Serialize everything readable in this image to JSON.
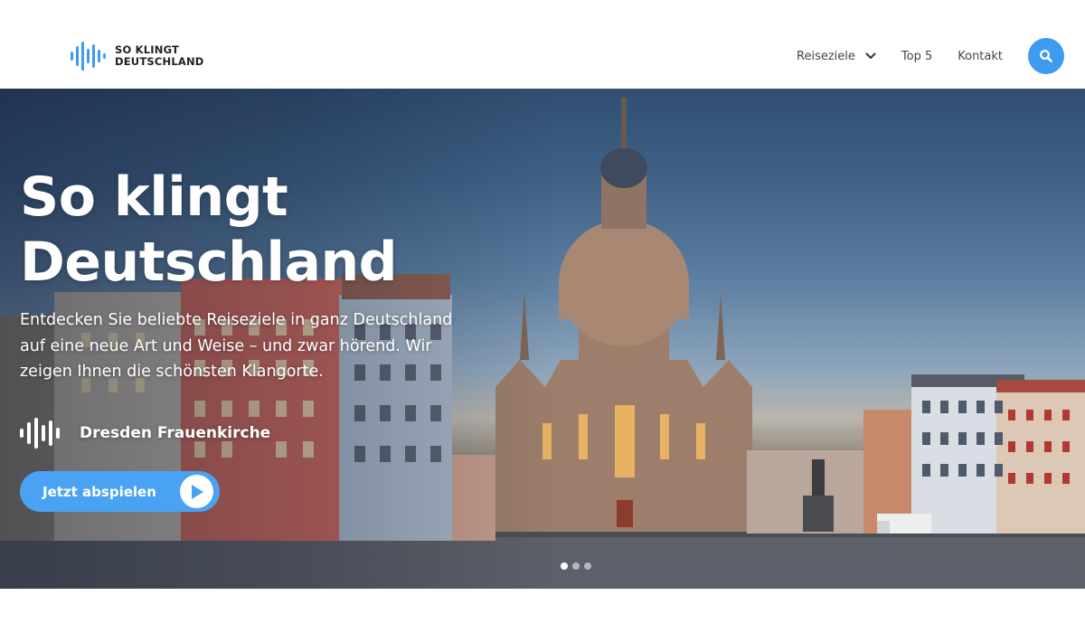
{
  "brand": {
    "line1": "SO KLINGT",
    "line2": "DEUTSCHLAND",
    "icon": "soundwave-logo-icon"
  },
  "nav": {
    "items": [
      {
        "label": "Reiseziele",
        "has_dropdown": true
      },
      {
        "label": "Top 5"
      },
      {
        "label": "Kontakt"
      }
    ],
    "search_icon": "search-icon"
  },
  "hero": {
    "title": "So klingt Deutschland",
    "subtitle": "Entdecken Sie beliebte Reiseziele in ganz Deutschland auf eine neue Art und Weise – und zwar hörend. Wir zeigen Ihnen die schönsten Klangorte.",
    "place_name": "Dresden Frauenkirche",
    "place_icon": "soundwave-icon",
    "play_label": "Jetzt abspielen",
    "play_icon": "play-icon",
    "slides": 3,
    "active_slide": 1
  },
  "colors": {
    "accent": "#3d9bf0",
    "button": "#4aa3f2",
    "text_dark": "#222222"
  }
}
